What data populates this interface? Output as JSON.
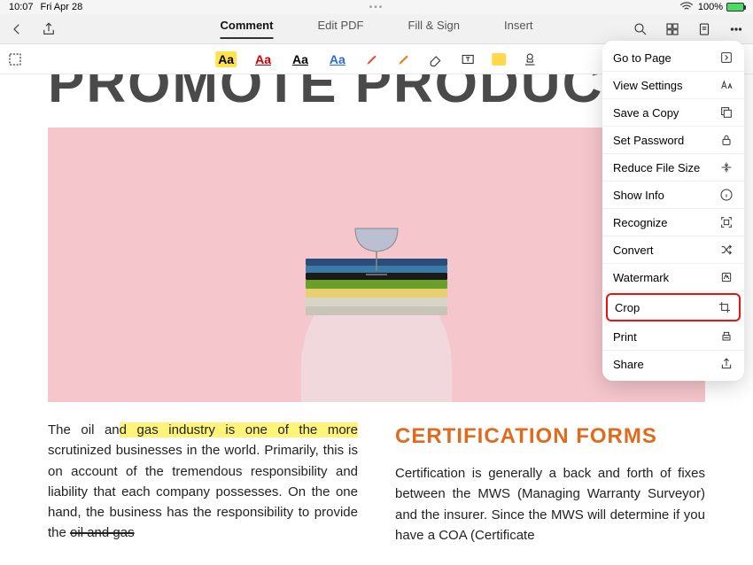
{
  "status": {
    "time": "10:07",
    "date": "Fri Apr 28",
    "battery": "100%"
  },
  "nav": {
    "tabs": {
      "comment": "Comment",
      "edit": "Edit PDF",
      "fillsign": "Fill & Sign",
      "insert": "Insert"
    }
  },
  "tools": {
    "aa": "Aa"
  },
  "doc": {
    "title": "PROMOTE PRODUCTIV",
    "col1_pre": "The oil an",
    "col1_hl": "d gas industry is one of the more",
    "col1_rest1": " scrutinized businesses in the world. Primarily, this is on account of the tremendous responsibility and liability that each company possesses. On the one hand, the business has the responsibility to provide the ",
    "col1_strike": "oil and gas",
    "col2_h": "CERTIFICATION FORMS",
    "col2_body": "Certification is generally a back and forth of fixes between the MWS (Managing Warranty Surveyor) and the insurer. Since the MWS will determine if you have a COA (Certificate"
  },
  "menu": {
    "go_to_page": "Go to Page",
    "view_settings": "View Settings",
    "save_copy": "Save a Copy",
    "set_password": "Set Password",
    "reduce": "Reduce File Size",
    "show_info": "Show Info",
    "recognize": "Recognize",
    "convert": "Convert",
    "watermark": "Watermark",
    "crop": "Crop",
    "print": "Print",
    "share": "Share"
  }
}
